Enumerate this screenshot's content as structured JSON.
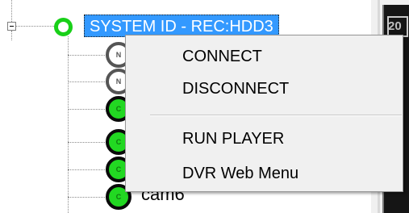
{
  "tree": {
    "root_label": "SYSTEM ID - REC:HDD3",
    "root_status_color": "#18d018",
    "children": [
      {
        "badge": "N",
        "status": "offline",
        "color": "#ffffff"
      },
      {
        "badge": "N",
        "status": "offline",
        "color": "#ffffff"
      },
      {
        "badge": "C",
        "status": "online",
        "color": "#22d822"
      },
      {
        "badge": "C",
        "status": "online",
        "color": "#22d822"
      },
      {
        "badge": "C",
        "status": "online",
        "color": "#22d822"
      },
      {
        "badge": "C",
        "status": "online",
        "color": "#22d822",
        "label": "cam6"
      }
    ]
  },
  "context_menu": {
    "items": [
      "CONNECT",
      "DISCONNECT",
      "RUN PLAYER",
      "DVR Web Menu"
    ]
  },
  "right_panel": {
    "thumb_text": "20"
  }
}
